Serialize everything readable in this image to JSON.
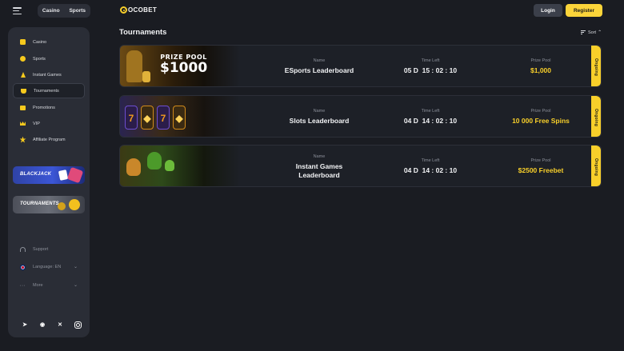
{
  "header": {
    "switch": [
      "Casino",
      "Sports"
    ],
    "logo": "OCOBET",
    "login": "Login",
    "register": "Register"
  },
  "sidebar": {
    "items": [
      {
        "label": "Casino",
        "icon": "casino-icon"
      },
      {
        "label": "Sports",
        "icon": "sports-icon"
      },
      {
        "label": "Instant Games",
        "icon": "instant-games-icon"
      },
      {
        "label": "Tournaments",
        "icon": "trophy-icon",
        "active": true
      },
      {
        "label": "Promotions",
        "icon": "gift-icon"
      },
      {
        "label": "VIP",
        "icon": "crown-icon"
      },
      {
        "label": "Affiliate Program",
        "icon": "star-icon"
      }
    ],
    "promos": [
      {
        "label": "BLACKJACK"
      },
      {
        "label": "TOURNAMENTS"
      }
    ],
    "support": "Support",
    "language": "Language: EN",
    "more": "More",
    "socials": [
      "telegram",
      "discord",
      "x",
      "instagram"
    ]
  },
  "main": {
    "title": "Tournaments",
    "sort": "Sort",
    "columns": {
      "name": "Name",
      "time": "Time Left",
      "prize": "Prize Pool"
    },
    "tournaments": [
      {
        "banner_top": "PRIZE POOL",
        "banner_amount": "$1000",
        "name": "ESports Leaderboard",
        "time": "05 D  15 : 02 : 10",
        "prize": "$1,000",
        "status": "Ongoing"
      },
      {
        "name": "Slots Leaderboard",
        "time": "04 D  14 : 02 : 10",
        "prize": "10 000 Free Spins",
        "status": "Ongoing"
      },
      {
        "name": "Instant Games Leaderboard",
        "time": "04 D  14 : 02 : 10",
        "prize": "$2500 Freebet",
        "status": "Ongoing"
      }
    ]
  },
  "colors": {
    "accent": "#f8cf2a",
    "background": "#1a1c22",
    "panel": "#2a2d36"
  }
}
